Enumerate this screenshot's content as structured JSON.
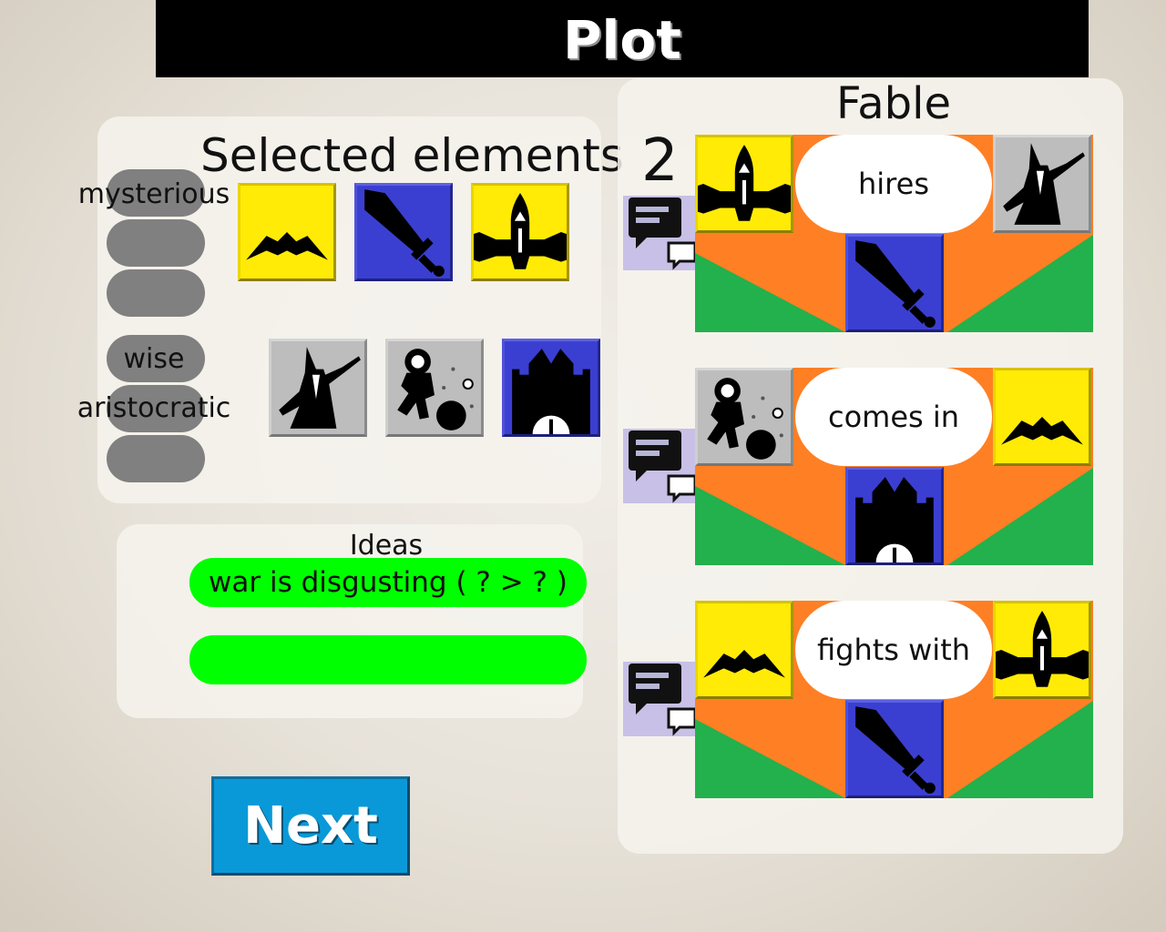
{
  "title": "Plot",
  "selected": {
    "heading": "Selected elements",
    "group1_attributes": [
      "mysterious",
      "",
      ""
    ],
    "group1_tiles": [
      "bat-icon",
      "sword-icon",
      "spaceship-icon"
    ],
    "group2_attributes": [
      "wise",
      "aristocratic",
      ""
    ],
    "group2_tiles": [
      "wizard-icon",
      "astronaut-icon",
      "castle-icon"
    ]
  },
  "ideas": {
    "heading": "Ideas",
    "items": [
      "war is disgusting ( ? > ? )",
      ""
    ]
  },
  "fable": {
    "heading": "Fable",
    "count": "2",
    "scenes": [
      {
        "left": "spaceship-icon",
        "verb": "hires",
        "right": "wizard-icon",
        "object": "sword-icon"
      },
      {
        "left": "astronaut-icon",
        "verb": "comes in",
        "right": "bat-icon",
        "object": "castle-icon"
      },
      {
        "left": "bat-icon",
        "verb": "fights with",
        "right": "spaceship-icon",
        "object": "sword-icon"
      }
    ]
  },
  "next_label": "Next",
  "colors": {
    "idea_green": "#00ff00",
    "next_blue": "#0a99d8",
    "scene_orange": "#ff7f24",
    "scene_green": "#22b14c"
  }
}
